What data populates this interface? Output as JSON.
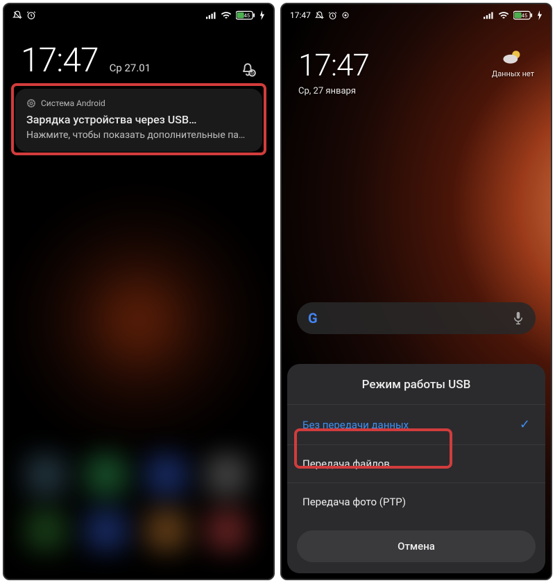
{
  "phone1": {
    "statusbar": {
      "time_hidden": ""
    },
    "clock": {
      "time": "17:47",
      "date": "Ср 27.01"
    },
    "notification": {
      "app": "Система Android",
      "title": "Зарядка устройства через USB…",
      "body": "Нажмите, чтобы показать дополнительные па…"
    }
  },
  "phone2": {
    "statusbar": {
      "time": "17:47"
    },
    "clock": {
      "time": "17:47",
      "date": "Ср, 27 января"
    },
    "weather": {
      "label": "Данных нет"
    },
    "search": {
      "placeholder": ""
    },
    "sheet": {
      "title": "Режим работы USB",
      "options": [
        {
          "label": "Без передачи данных",
          "selected": true
        },
        {
          "label": "Передача файлов",
          "selected": false
        },
        {
          "label": "Передача фото (PTP)",
          "selected": false
        }
      ],
      "cancel": "Отмена"
    }
  },
  "battery_label": "45"
}
